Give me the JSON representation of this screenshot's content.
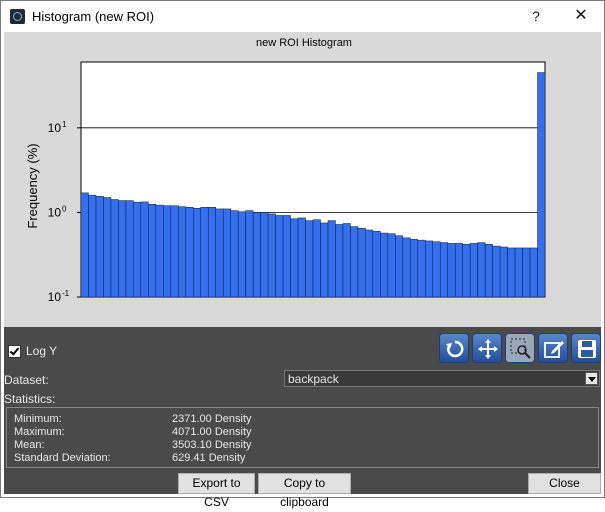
{
  "window": {
    "title": "Histogram (new ROI)",
    "help": "?",
    "close": "✕"
  },
  "chart_data": {
    "type": "bar",
    "title": "new ROI Histogram",
    "ylabel": "Frequency (%)",
    "xlabel": "",
    "yscale": "log",
    "ylim": [
      0.1,
      60
    ],
    "yticks": [
      {
        "mantissa": "10",
        "exp": "-1",
        "value": 0.1
      },
      {
        "mantissa": "10",
        "exp": "0",
        "value": 1
      },
      {
        "mantissa": "10",
        "exp": "1",
        "value": 10
      }
    ],
    "grid": "horizontal",
    "bar_color": "#3370f0",
    "values": [
      1.7,
      1.6,
      1.55,
      1.5,
      1.42,
      1.38,
      1.38,
      1.32,
      1.33,
      1.25,
      1.22,
      1.2,
      1.2,
      1.17,
      1.15,
      1.12,
      1.15,
      1.15,
      1.1,
      1.1,
      1.05,
      1.02,
      1.05,
      1.0,
      1.0,
      0.96,
      0.92,
      0.92,
      0.84,
      0.86,
      0.8,
      0.82,
      0.75,
      0.8,
      0.72,
      0.74,
      0.68,
      0.65,
      0.62,
      0.6,
      0.57,
      0.56,
      0.53,
      0.5,
      0.48,
      0.47,
      0.46,
      0.45,
      0.44,
      0.43,
      0.43,
      0.42,
      0.43,
      0.44,
      0.42,
      0.4,
      0.39,
      0.38,
      0.38,
      0.38,
      0.38,
      45
    ]
  },
  "controls": {
    "logy_label": "Log Y",
    "logy_checked": true,
    "dataset_label": "Dataset:",
    "dataset_value": "backpack",
    "statistics_label": "Statistics:",
    "stats": [
      {
        "name": "Minimum:",
        "value": "2371.00 Density"
      },
      {
        "name": "Maximum:",
        "value": "4071.00 Density"
      },
      {
        "name": "Mean:",
        "value": "3503.10 Density"
      },
      {
        "name": "Standard Deviation:",
        "value": "629.41 Density"
      }
    ],
    "export_csv": "Export to CSV",
    "copy_clipboard": "Copy to clipboard",
    "close": "Close"
  },
  "toolbar_icons": [
    "reset-view-icon",
    "pan-icon",
    "zoom-rect-icon",
    "edit-icon",
    "save-icon"
  ]
}
